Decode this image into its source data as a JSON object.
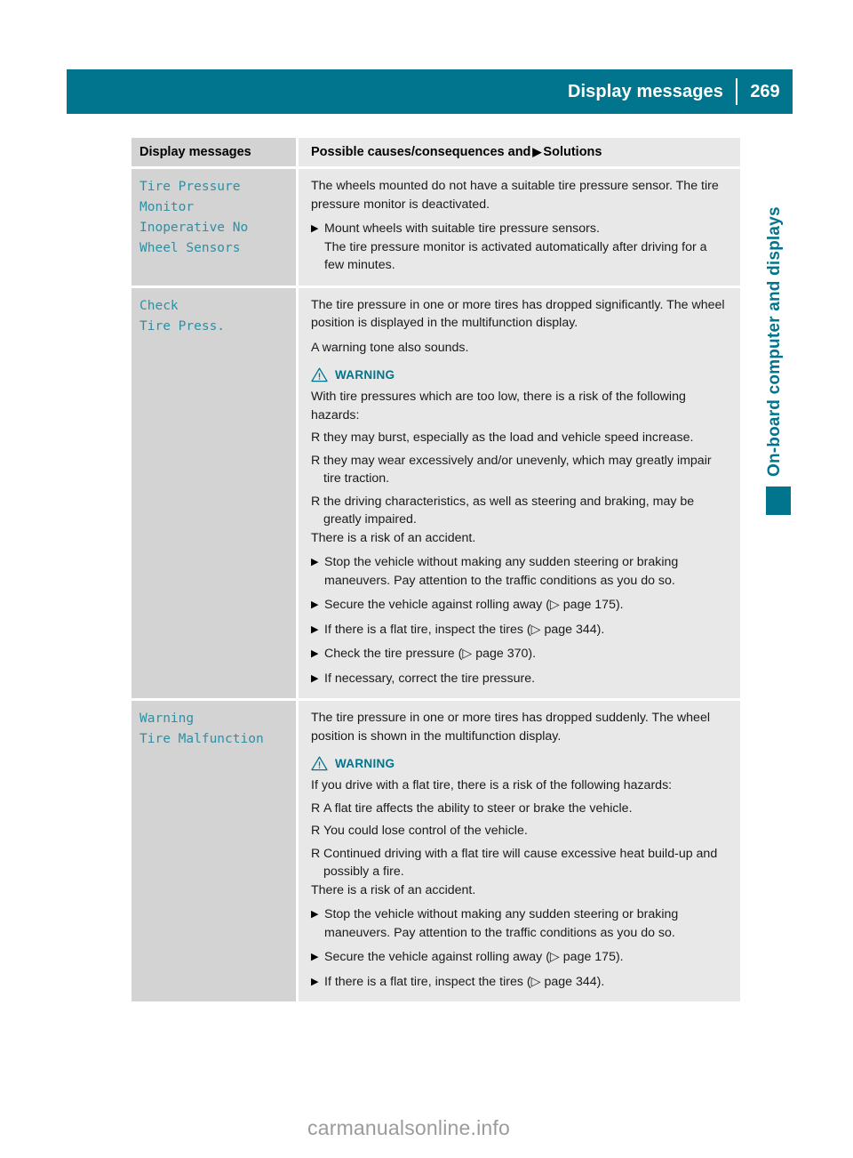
{
  "header": {
    "title": "Display messages",
    "page_number": "269",
    "bar_color": "#00758d"
  },
  "side_tab": {
    "label": "On-board computer and displays",
    "color": "#00758d"
  },
  "table": {
    "columns": {
      "left_header": "Display messages",
      "right_header_before": "Possible causes/consequences and",
      "right_header_triangle": "▶",
      "right_header_after": "Solutions"
    },
    "rows": [
      {
        "message": "Tire Pressure\nMonitor\nInoperative No\nWheel Sensors",
        "paragraphs": [
          "The wheels mounted do not have a suitable tire pressure sensor. The tire pressure monitor is deactivated."
        ],
        "steps": [
          {
            "text": "Mount wheels with suitable tire pressure sensors.",
            "sub": "The tire pressure monitor is activated automatically after driving for a few minutes."
          }
        ]
      },
      {
        "message": "Check\nTire Press.",
        "paragraphs": [
          "The tire pressure in one or more tires has dropped significantly. The wheel position is displayed in the multifunction display.",
          "A warning tone also sounds."
        ],
        "warning": {
          "label": "WARNING",
          "intro": "With tire pressures which are too low, there is a risk of the following hazards:",
          "bullets": [
            "they may burst, especially as the load and vehicle speed increase.",
            "they may wear excessively and/or unevenly, which may greatly impair tire traction.",
            "the driving characteristics, as well as steering and braking, may be greatly impaired."
          ],
          "outro": "There is a risk of an accident."
        },
        "steps": [
          {
            "text": "Stop the vehicle without making any sudden steering or braking maneuvers. Pay attention to the traffic conditions as you do so.",
            "sub": ""
          },
          {
            "text": "Secure the vehicle against rolling away (▷ page 175).",
            "sub": ""
          },
          {
            "text": "If there is a flat tire, inspect the tires (▷ page 344).",
            "sub": ""
          },
          {
            "text": "Check the tire pressure (▷ page 370).",
            "sub": ""
          },
          {
            "text": "If necessary, correct the tire pressure.",
            "sub": ""
          }
        ]
      },
      {
        "message": "Warning\nTire Malfunction",
        "paragraphs": [
          "The tire pressure in one or more tires has dropped suddenly. The wheel position is shown in the multifunction display."
        ],
        "warning": {
          "label": "WARNING",
          "intro": "If you drive with a flat tire, there is a risk of the following hazards:",
          "bullets": [
            "A flat tire affects the ability to steer or brake the vehicle.",
            "You could lose control of the vehicle.",
            "Continued driving with a flat tire will cause excessive heat build-up and possibly a fire."
          ],
          "outro": "There is a risk of an accident."
        },
        "steps": [
          {
            "text": "Stop the vehicle without making any sudden steering or braking maneuvers. Pay attention to the traffic conditions as you do so.",
            "sub": ""
          },
          {
            "text": "Secure the vehicle against rolling away (▷ page 175).",
            "sub": ""
          },
          {
            "text": "If there is a flat tire, inspect the tires (▷ page 344).",
            "sub": ""
          }
        ]
      }
    ],
    "markers": {
      "step_triangle": "▶",
      "bullet": "R"
    }
  },
  "watermark": "carmanualsonline.info"
}
